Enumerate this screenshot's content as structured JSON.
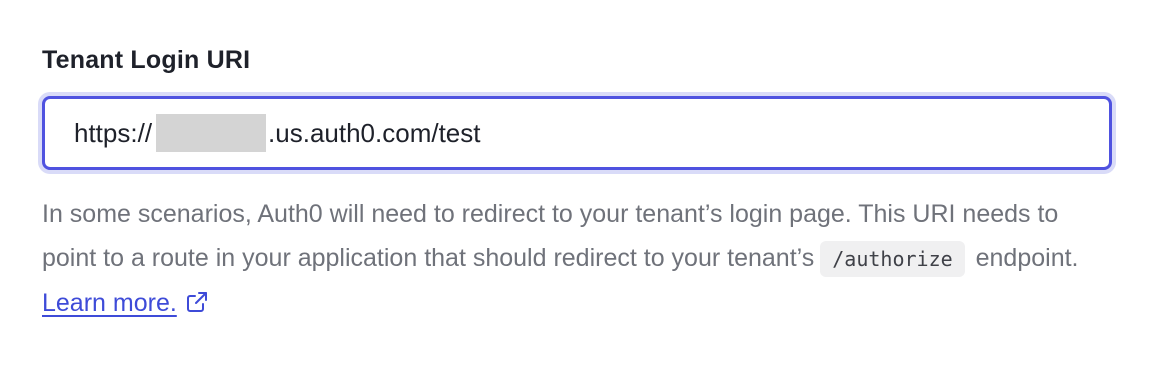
{
  "field": {
    "label": "Tenant Login URI",
    "value_prefix": "https://",
    "value_suffix": ".us.auth0.com/test"
  },
  "help": {
    "text_before_code": "In some scenarios, Auth0 will need to redirect to your tenant’s login page. This URI needs to point to a route in your application that should redirect to your tenant’s",
    "code": "/authorize",
    "text_after_code": " endpoint. ",
    "link_text": "Learn more.",
    "link_icon": "external-link-icon"
  },
  "colors": {
    "focus_border": "#4f52e0",
    "focus_ring": "#d9dbf8",
    "link": "#3e4bd8",
    "help_text": "#6f727a"
  }
}
